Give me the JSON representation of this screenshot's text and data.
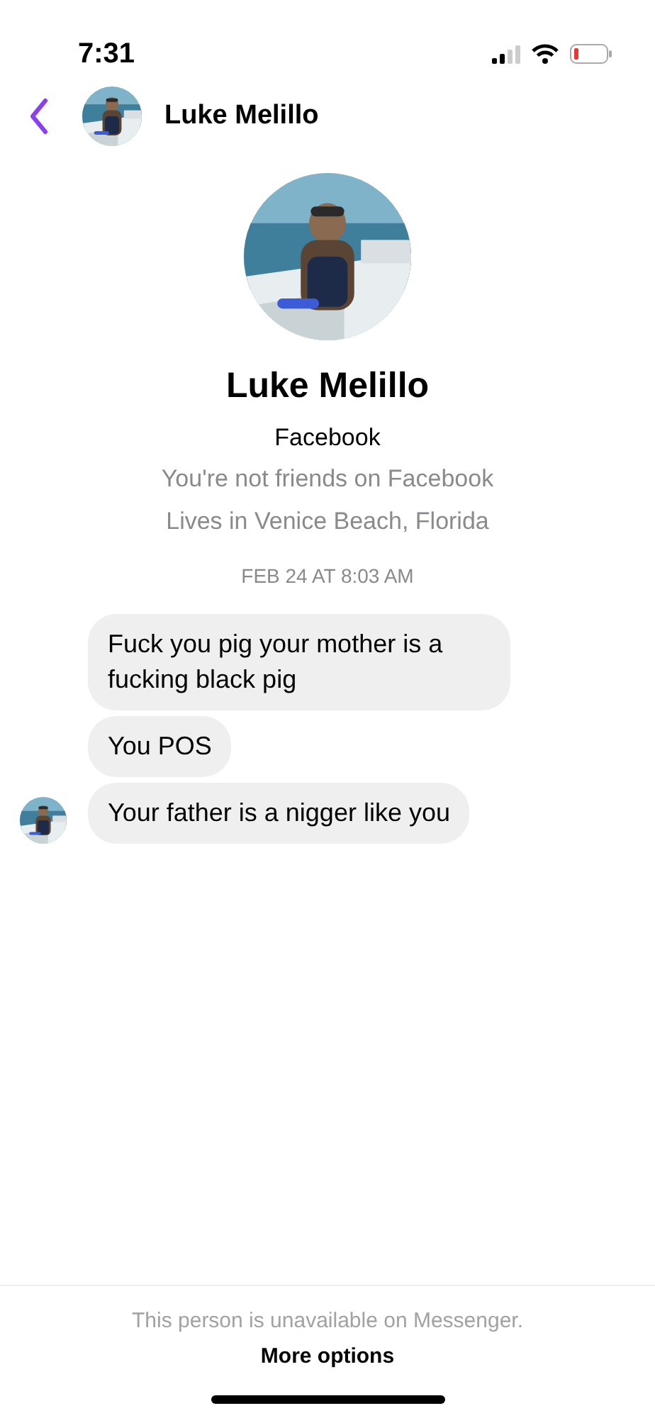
{
  "status_bar": {
    "time": "7:31"
  },
  "header": {
    "contact_name": "Luke Melillo"
  },
  "profile": {
    "name": "Luke Melillo",
    "source": "Facebook",
    "friendship": "You're not friends on Facebook",
    "location": "Lives in Venice Beach, Florida"
  },
  "timestamp": "FEB 24 AT 8:03 AM",
  "messages": [
    {
      "text": "Fuck you pig your mother is a fucking black pig",
      "show_avatar": false
    },
    {
      "text": "You POS",
      "show_avatar": false
    },
    {
      "text": "Your father is a nigger like you",
      "show_avatar": true
    }
  ],
  "footer": {
    "notice": "This person is unavailable on Messenger.",
    "action": "More options"
  }
}
